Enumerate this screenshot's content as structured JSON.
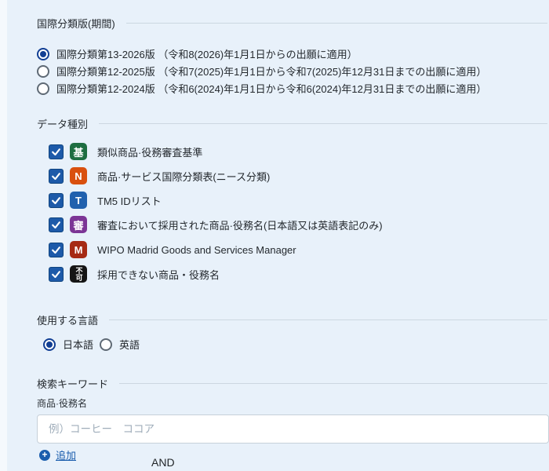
{
  "colors": {
    "background": "#e8f1fa",
    "accent_blue": "#1d5aa9",
    "link_blue": "#1a5dad",
    "divider": "#ccd7e1"
  },
  "sections": {
    "classification": {
      "title": "国際分類版(期間)",
      "options": [
        {
          "label": "国際分類第13-2026版 （令和8(2026)年1月1日からの出願に適用）",
          "selected": true
        },
        {
          "label": "国際分類第12-2025版 （令和7(2025)年1月1日から令和7(2025)年12月31日までの出願に適用）",
          "selected": false
        },
        {
          "label": "国際分類第12-2024版 （令和6(2024)年1月1日から令和6(2024)年12月31日までの出願に適用）",
          "selected": false
        }
      ]
    },
    "data_type": {
      "title": "データ種別",
      "items": [
        {
          "icon": "基",
          "icon_color": "#1e6e41",
          "label": "類似商品·役務審査基準",
          "checked": true
        },
        {
          "icon": "N",
          "icon_color": "#d9500f",
          "label": "商品·サービス国際分類表(ニース分類)",
          "checked": true
        },
        {
          "icon": "T",
          "icon_color": "#2161ae",
          "label": "TM5 IDリスト",
          "checked": true
        },
        {
          "icon": "審",
          "icon_color": "#7c3596",
          "label": "審査において採用された商品·役務名(日本語又は英語表記のみ)",
          "checked": true
        },
        {
          "icon": "M",
          "icon_color": "#a62a14",
          "label": "WIPO Madrid Goods and Services Manager",
          "checked": true
        },
        {
          "icon": "不可",
          "icon_color": "#151515",
          "label": "採用できない商品・役務名",
          "checked": true
        }
      ]
    },
    "language": {
      "title": "使用する言語",
      "options": [
        {
          "label": "日本語",
          "selected": true
        },
        {
          "label": "英語",
          "selected": false
        }
      ]
    },
    "keyword": {
      "title": "検索キーワード",
      "field_label": "商品·役務名",
      "placeholder": "例）コーヒー　ココア",
      "add_label": "追加",
      "operator": "AND"
    }
  }
}
